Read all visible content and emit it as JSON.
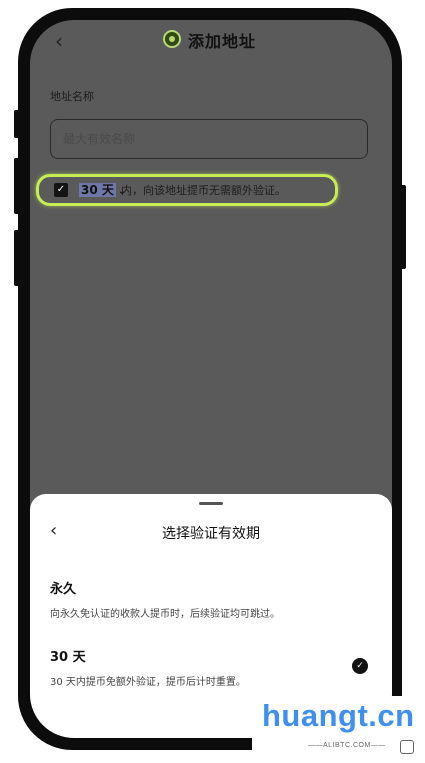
{
  "header": {
    "title": "添加地址",
    "back_glyph": "‹"
  },
  "form": {
    "name_label": "地址名称",
    "name_placeholder": "最大有效名称",
    "verify_row": {
      "checked": true,
      "period": "30 天",
      "description": "内，向该地址提币无需额外验证。"
    }
  },
  "sheet": {
    "title": "选择验证有效期",
    "back_glyph": "‹",
    "options": [
      {
        "title": "永久",
        "description": "向永久免认证的收款人提币时，后续验证均可跳过。",
        "selected": false
      },
      {
        "title": "30 天",
        "description": "30 天内提币免额外验证，提币后计时重置。",
        "selected": true
      }
    ]
  },
  "watermark": {
    "text": "huangt.cn",
    "subtext": "——ALIBTC.COM——"
  },
  "colors": {
    "highlight_ring": "#c7ec55",
    "overlay": "#5a5a5a",
    "watermark": "#3f8ff0"
  }
}
